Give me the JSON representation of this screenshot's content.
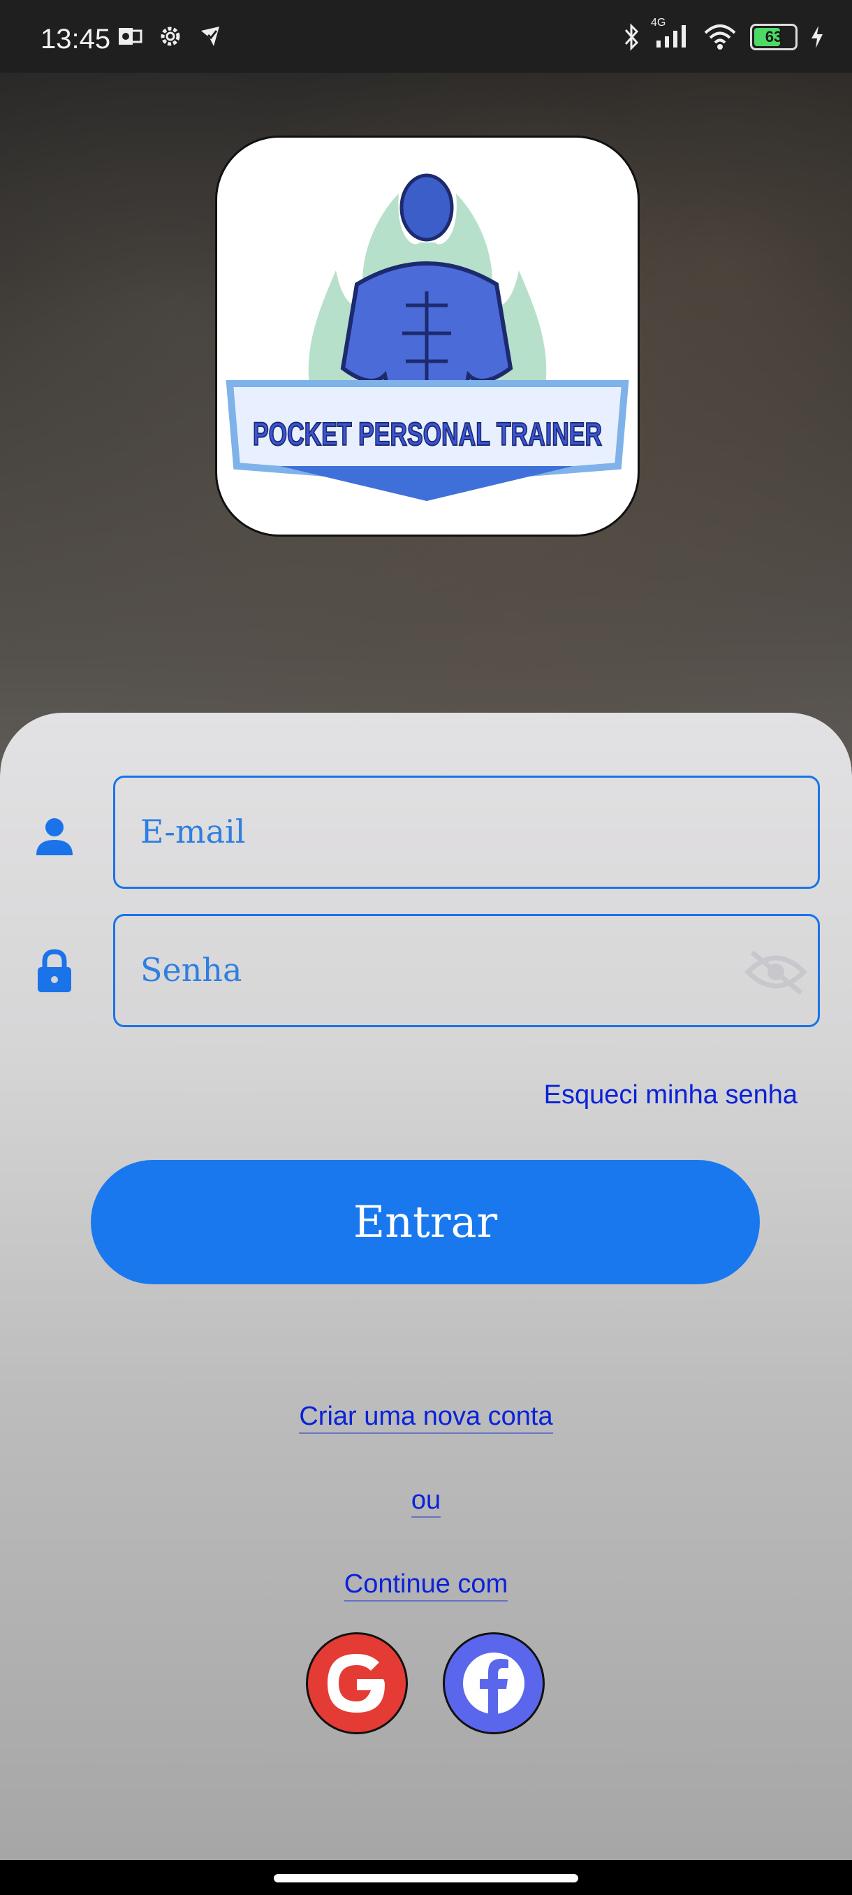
{
  "status_bar": {
    "time": "13:45",
    "network": "4G",
    "battery": "63",
    "icons": [
      "outlook-icon",
      "settings-gear-icon",
      "vpn-shield-icon",
      "bluetooth-icon",
      "signal-icon",
      "wifi-icon",
      "battery-icon",
      "charging-icon"
    ]
  },
  "logo": {
    "text": "POCKET PERSONAL TRAINER"
  },
  "login": {
    "email_placeholder": "E-mail",
    "password_placeholder": "Senha",
    "forgot_link": "Esqueci minha senha",
    "enter_button": "Entrar",
    "create_account_link": "Criar uma nova conta",
    "or_text": "ou",
    "continue_with": "Continue com"
  },
  "social": {
    "google": "google-icon",
    "facebook": "facebook-icon"
  },
  "colors": {
    "accent": "#1a78ee",
    "link": "#0a22d8",
    "google": "#e53b35",
    "facebook": "#5a67ec"
  }
}
